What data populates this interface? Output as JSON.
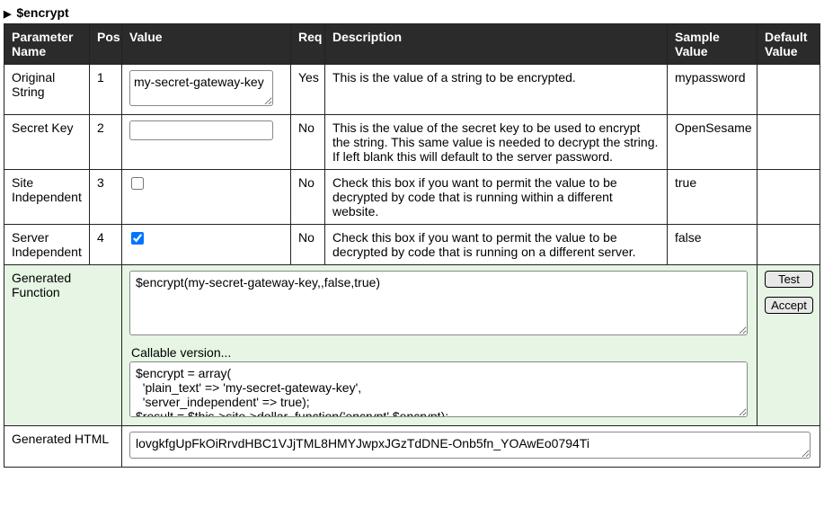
{
  "title": "$encrypt",
  "columns": {
    "param": "Parameter Name",
    "pos": "Pos",
    "value": "Value",
    "req": "Req",
    "desc": "Description",
    "sample": "Sample Value",
    "default": "Default Value"
  },
  "rows": [
    {
      "param": "Original String",
      "pos": "1",
      "input_type": "textarea",
      "value": "my-secret-gateway-key",
      "req": "Yes",
      "desc": "This is the value of a string to be encrypted.",
      "sample": "mypassword",
      "default": ""
    },
    {
      "param": "Secret Key",
      "pos": "2",
      "input_type": "text",
      "value": "",
      "req": "No",
      "desc": "This is the value of the secret key to be used to encrypt the string. This same value is needed to decrypt the string. If left blank this will default to the server password.",
      "sample": "OpenSesame",
      "default": ""
    },
    {
      "param": "Site Independent",
      "pos": "3",
      "input_type": "checkbox",
      "checked": false,
      "req": "No",
      "desc": "Check this box if you want to permit the value to be decrypted by code that is running within a different website.",
      "sample": "true",
      "default": ""
    },
    {
      "param": "Server Independent",
      "pos": "4",
      "input_type": "checkbox",
      "checked": true,
      "req": "No",
      "desc": "Check this box if you want to permit the value to be decrypted by code that is running on a different server.",
      "sample": "false",
      "default": ""
    }
  ],
  "generated": {
    "label": "Generated Function",
    "function_text": "$encrypt(my-secret-gateway-key,,false,true)",
    "callable_label": "Callable version...",
    "callable_text": "$encrypt = array(\n  'plain_text' => 'my-secret-gateway-key',\n  'server_independent' => true);\n$result = $this->site->dollar_function('encrypt',$encrypt);",
    "test_label": "Test",
    "accept_label": "Accept"
  },
  "generated_html": {
    "label": "Generated HTML",
    "value": "lovgkfgUpFkOiRrvdHBC1VJjTML8HMYJwpxJGzTdDNE-Onb5fn_YOAwEo0794Ti"
  }
}
